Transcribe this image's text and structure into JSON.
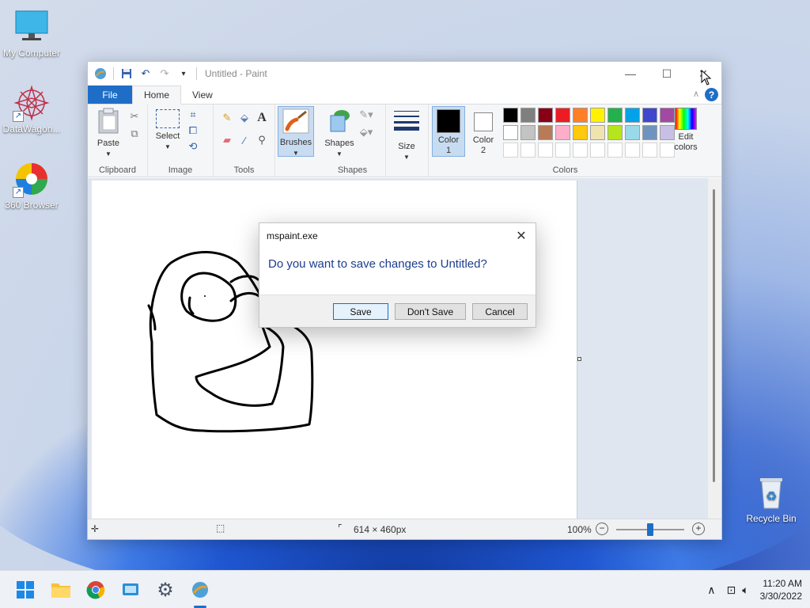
{
  "desktop": {
    "icons": [
      {
        "label": "My Computer"
      },
      {
        "label": "DataWagon..."
      },
      {
        "label": "360 Browser"
      },
      {
        "label": "Recycle Bin"
      }
    ]
  },
  "window": {
    "title": "Untitled - Paint",
    "tabs": {
      "file": "File",
      "home": "Home",
      "view": "View"
    },
    "help": "?"
  },
  "ribbon": {
    "clipboard": {
      "paste": "Paste",
      "label": "Clipboard"
    },
    "image": {
      "select": "Select",
      "label": "Image"
    },
    "tools": {
      "label": "Tools",
      "text_tool": "A"
    },
    "brushes": {
      "label": "Brushes"
    },
    "shapes": {
      "shapes": "Shapes",
      "label": "Shapes"
    },
    "size": {
      "label": "Size"
    },
    "colors": {
      "color1_line1": "Color",
      "color1_line2": "1",
      "color2_line1": "Color",
      "color2_line2": "2",
      "edit_line1": "Edit",
      "edit_line2": "colors",
      "label": "Colors",
      "color1": "#000000",
      "color2": "#ffffff",
      "palette_row1": [
        "#000000",
        "#7f7f7f",
        "#880015",
        "#ed1c24",
        "#ff7f27",
        "#fff200",
        "#22b14c",
        "#00a2e8",
        "#3f48cc",
        "#a349a4"
      ],
      "palette_row2": [
        "#ffffff",
        "#c3c3c3",
        "#b97a57",
        "#ffaec9",
        "#ffc90e",
        "#efe4b0",
        "#b5e61d",
        "#99d9ea",
        "#7092be",
        "#c8bfe7"
      ]
    }
  },
  "statusbar": {
    "dimensions": "614 × 460px",
    "zoom": "100%",
    "zoom_level": 0.5
  },
  "dialog": {
    "title": "mspaint.exe",
    "message": "Do you want to save changes to Untitled?",
    "save": "Save",
    "dont_save": "Don't Save",
    "cancel": "Cancel"
  },
  "taskbar": {
    "time": "11:20 AM",
    "date": "3/30/2022"
  },
  "colors": {
    "accent": "#1e6ec7"
  }
}
